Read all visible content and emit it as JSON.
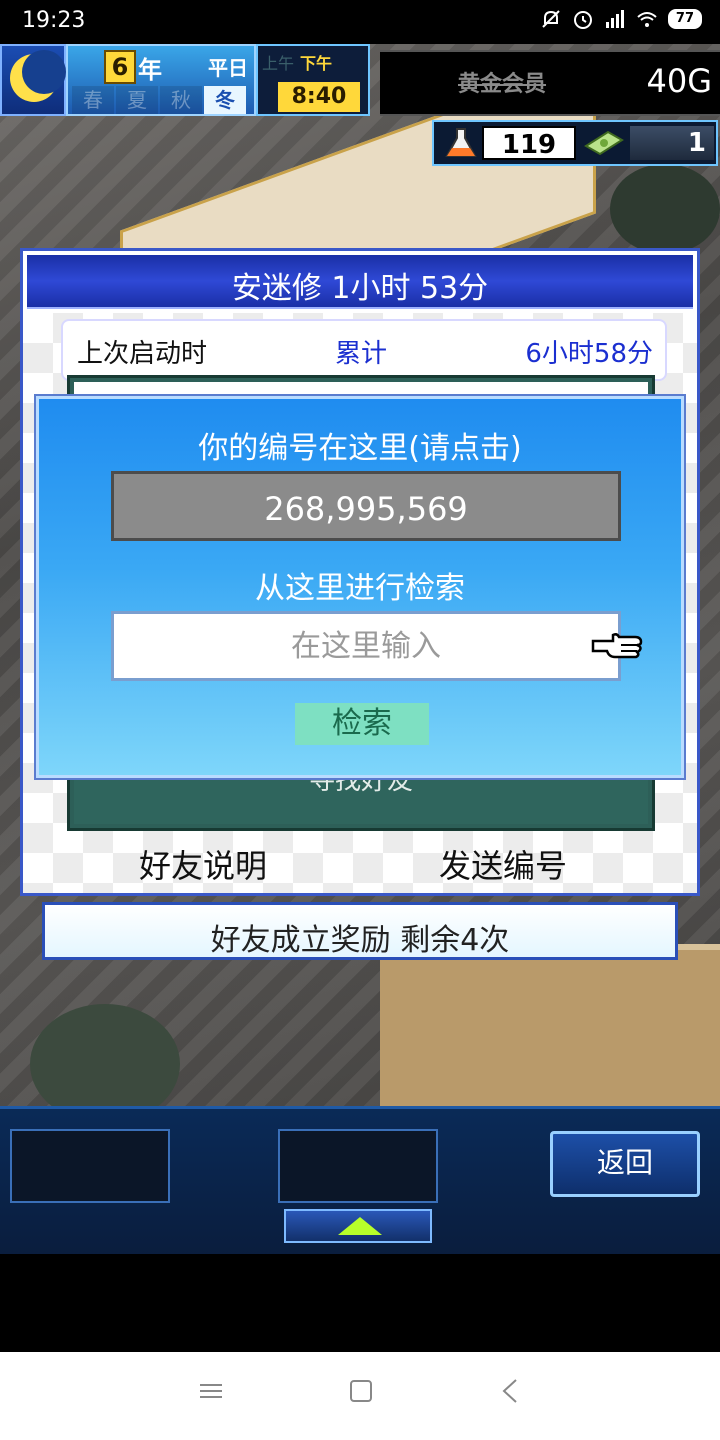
{
  "status_bar": {
    "time": "19:23",
    "battery": "77",
    "icons": [
      "mute-icon",
      "alarm-icon",
      "signal-icon",
      "wifi-icon",
      "battery-icon"
    ]
  },
  "hud": {
    "year_number": "6",
    "year_unit": "年",
    "weekday": "平日",
    "seasons": [
      "春",
      "夏",
      "秋",
      "冬"
    ],
    "active_season": "冬",
    "am_label": "上午",
    "pm_label": "下午",
    "clock": "8:40",
    "vip_label": "黄金会员",
    "gold": "40G",
    "research_points": "119",
    "tickets": "1"
  },
  "friend_panel": {
    "title": "安迷修  1小时 53分",
    "last_start_label": "上次启动时",
    "total_label": "累计",
    "total_time": "6小时58分",
    "find_friends_label": "寻找好友",
    "friend_desc_label": "好友说明",
    "send_id_label": "发送编号"
  },
  "reward_bar": {
    "text": "好友成立奖励  剩余4次"
  },
  "search_dialog": {
    "title": "你的编号在这里(请点击)",
    "player_id": "268,995,569",
    "search_label": "从这里进行检索",
    "input_placeholder": "在这里输入",
    "search_button": "检索"
  },
  "bottom_menu": {
    "back_label": "返回"
  },
  "colors": {
    "accent_blue": "#2f49d6",
    "dialog_top": "#1f8cf0",
    "dialog_bottom": "#7ed6fa",
    "search_button": "#7ee0c2"
  }
}
